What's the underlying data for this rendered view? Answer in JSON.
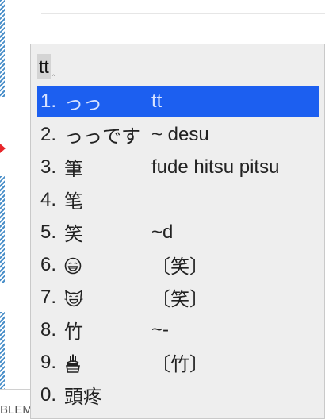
{
  "background": {
    "status_fragment": "BLEM",
    "caret_mark": "_"
  },
  "ime": {
    "composition": "tt",
    "composition_caret": "‸",
    "candidates": [
      {
        "number": "1.",
        "word": "っっ",
        "comment": "tt",
        "selected": true
      },
      {
        "number": "2.",
        "word": "っっです",
        "comment": "~ desu"
      },
      {
        "number": "3.",
        "word": "筆",
        "comment": "fude hitsu pitsu"
      },
      {
        "number": "4.",
        "word": "笔",
        "comment": ""
      },
      {
        "number": "5.",
        "word": "笑",
        "comment": "~d"
      },
      {
        "number": "6.",
        "word": "",
        "icon": "grinning-face-icon",
        "comment": "〔笑〕"
      },
      {
        "number": "7.",
        "word": "",
        "icon": "grinning-cat-icon",
        "comment": "〔笑〕"
      },
      {
        "number": "8.",
        "word": "竹",
        "comment": "~-"
      },
      {
        "number": "9.",
        "word": "",
        "icon": "kadomatsu-bamboo-icon",
        "comment": "〔竹〕"
      },
      {
        "number": "0.",
        "word": "頭疼",
        "comment": ""
      }
    ]
  },
  "colors": {
    "selected_bg": "#1c5ff0",
    "panel_bg": "#eeeeee",
    "marker_red": "#e8262a"
  }
}
